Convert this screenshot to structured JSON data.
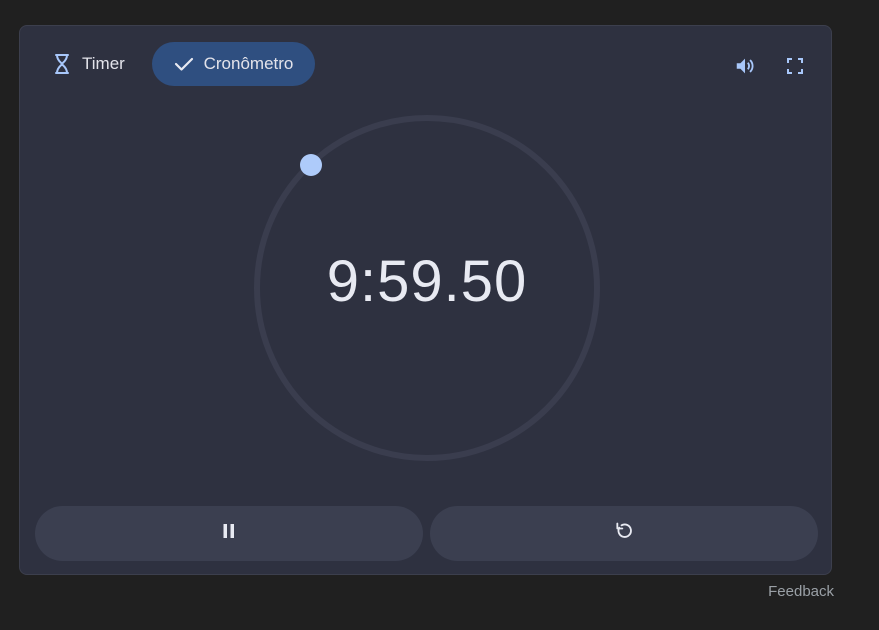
{
  "tabs": [
    {
      "label": "Timer",
      "icon": "hourglass-icon",
      "selected": false
    },
    {
      "label": "Cronômetro",
      "icon": "check-icon",
      "selected": true
    }
  ],
  "toolbar": {
    "sound_icon": "volume-icon",
    "fullscreen_icon": "fullscreen-icon"
  },
  "stopwatch": {
    "time": "9:59.50"
  },
  "controls": {
    "pause_icon": "pause-icon",
    "reset_icon": "reset-icon"
  },
  "footer": {
    "feedback_label": "Feedback"
  },
  "colors": {
    "accent": "#2f4f80",
    "knob": "#aecbfa",
    "ring": "#3a3d4e"
  }
}
